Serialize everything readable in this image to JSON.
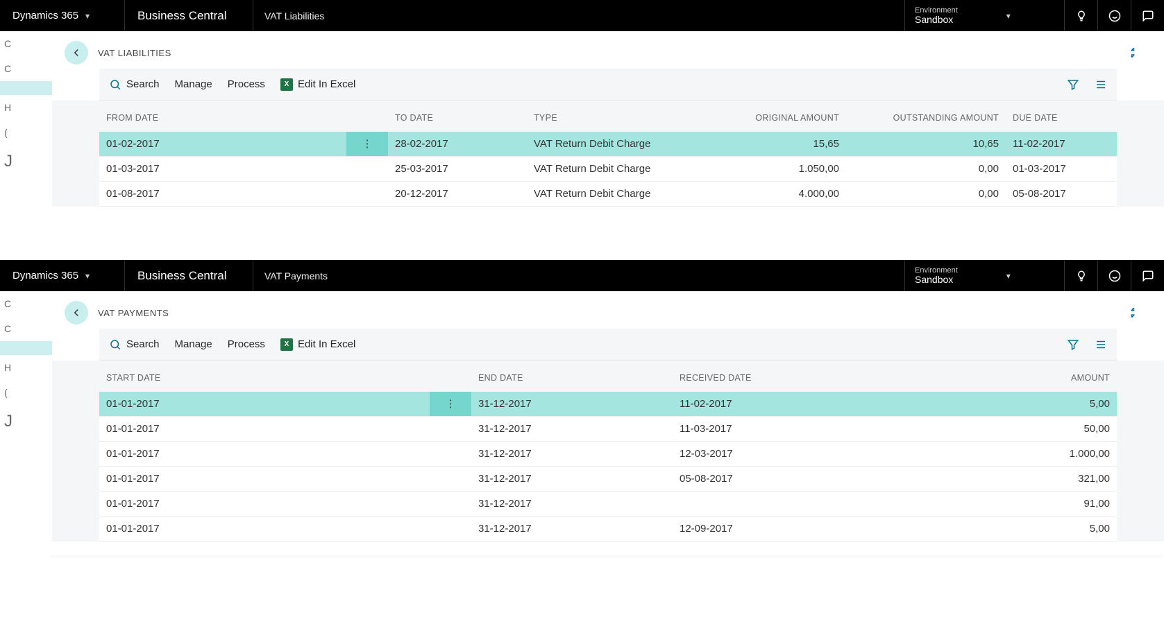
{
  "product": "Dynamics 365",
  "app": "Business Central",
  "env_label": "Environment",
  "env_value": "Sandbox",
  "panels": [
    {
      "breadcrumb": "VAT Liabilities",
      "title": "VAT LIABILITIES",
      "toolbar": {
        "search": "Search",
        "manage": "Manage",
        "process": "Process",
        "excel": "Edit In Excel"
      },
      "columns": [
        {
          "label": "FROM DATE",
          "align": "left",
          "w": "270"
        },
        {
          "label": "TO DATE",
          "align": "left",
          "w": "200"
        },
        {
          "label": "TYPE",
          "align": "left",
          "w": "300"
        },
        {
          "label": "ORIGINAL AMOUNT",
          "align": "right",
          "w": "160"
        },
        {
          "label": "OUTSTANDING AMOUNT",
          "align": "right",
          "w": "230"
        },
        {
          "label": "DUE DATE",
          "align": "left",
          "w": "160"
        }
      ],
      "rows": [
        {
          "sel": true,
          "cells": [
            "01-02-2017",
            "28-02-2017",
            "VAT Return Debit Charge",
            "15,65",
            "10,65",
            "11-02-2017"
          ]
        },
        {
          "sel": false,
          "cells": [
            "01-03-2017",
            "25-03-2017",
            "VAT Return Debit Charge",
            "1.050,00",
            "0,00",
            "01-03-2017"
          ]
        },
        {
          "sel": false,
          "cells": [
            "01-08-2017",
            "20-12-2017",
            "VAT Return Debit Charge",
            "4.000,00",
            "0,00",
            "05-08-2017"
          ]
        }
      ]
    },
    {
      "breadcrumb": "VAT Payments",
      "title": "VAT PAYMENTS",
      "toolbar": {
        "search": "Search",
        "manage": "Manage",
        "process": "Process",
        "excel": "Edit In Excel"
      },
      "columns": [
        {
          "label": "START DATE",
          "align": "left",
          "w": "390"
        },
        {
          "label": "END DATE",
          "align": "left",
          "w": "290"
        },
        {
          "label": "RECEIVED DATE",
          "align": "left",
          "w": "430"
        },
        {
          "label": "AMOUNT",
          "align": "right",
          "w": "210"
        }
      ],
      "rows": [
        {
          "sel": true,
          "cells": [
            "01-01-2017",
            "31-12-2017",
            "11-02-2017",
            "5,00"
          ]
        },
        {
          "sel": false,
          "cells": [
            "01-01-2017",
            "31-12-2017",
            "11-03-2017",
            "50,00"
          ]
        },
        {
          "sel": false,
          "cells": [
            "01-01-2017",
            "31-12-2017",
            "12-03-2017",
            "1.000,00"
          ]
        },
        {
          "sel": false,
          "cells": [
            "01-01-2017",
            "31-12-2017",
            "05-08-2017",
            "321,00"
          ]
        },
        {
          "sel": false,
          "cells": [
            "01-01-2017",
            "31-12-2017",
            "",
            "91,00"
          ]
        },
        {
          "sel": false,
          "cells": [
            "01-01-2017",
            "31-12-2017",
            "12-09-2017",
            "5,00"
          ]
        }
      ]
    }
  ]
}
